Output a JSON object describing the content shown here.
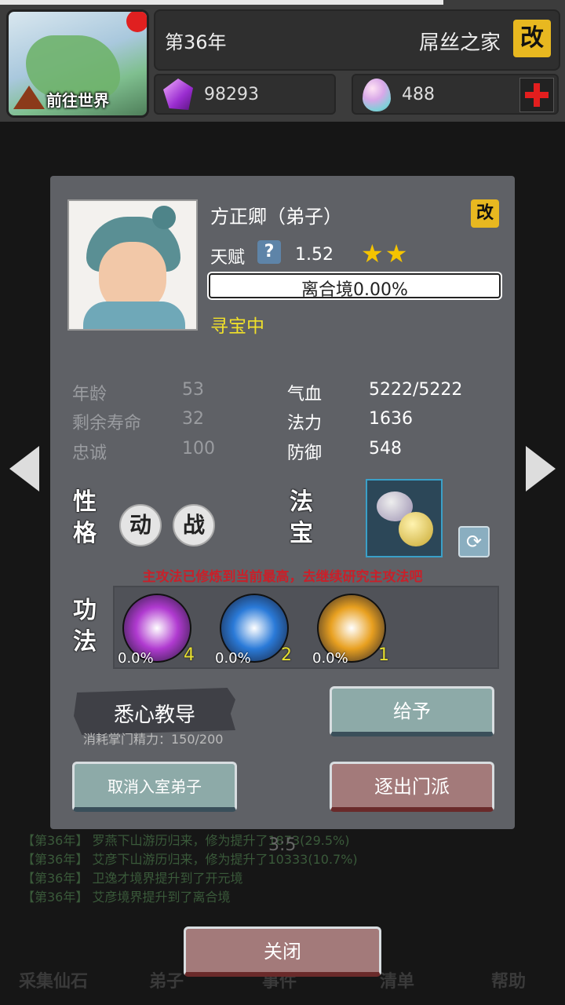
{
  "header": {
    "world_button_label": "前往世界",
    "year": "第36年",
    "sect_name": "屌丝之家",
    "rename_icon": "改",
    "spirit_stones": "98293",
    "eggs": "488"
  },
  "background": {
    "logs": [
      "【第36年】 罗燕下山游历归来，修为提升了1873(29.5%)",
      "【第36年】 艾彦下山游历归来，修为提升了10333(10.7%)",
      "【第36年】 卫逸才境界提升到了开元境",
      "【第36年】 艾彦境界提升到了离合境"
    ],
    "timer": "3:5",
    "bottom_tabs": [
      "采集仙石",
      "弟子",
      "事件",
      "清单",
      "帮助"
    ]
  },
  "disciple": {
    "name": "方正卿（弟子）",
    "rename_icon": "改",
    "talent_label": "天赋",
    "talent_help": "?",
    "talent_value": "1.52",
    "stars": "★★",
    "star_count": 2,
    "realm_progress_text": "离合境0.00%",
    "realm_progress": 0.0,
    "status": "寻宝中",
    "stats": {
      "age_label": "年龄",
      "age": "53",
      "life_label": "剩余寿命",
      "life": "32",
      "loyalty_label": "忠诚",
      "loyalty": "100",
      "hp_label": "气血",
      "hp": "5222/5222",
      "mana_label": "法力",
      "mana": "1636",
      "def_label": "防御",
      "def": "548"
    },
    "personality_label": [
      "性",
      "格"
    ],
    "traits": [
      "动",
      "战"
    ],
    "treasure_label": [
      "法",
      "宝"
    ],
    "refresh_icon": "⟳",
    "skills_hint": "主攻法已修炼到当前最高，去继续研究主攻法吧",
    "skills_label": [
      "功",
      "法"
    ],
    "skills": [
      {
        "progress": "0.0%",
        "level": "4",
        "color": "#b03ad0"
      },
      {
        "progress": "0.0%",
        "level": "2",
        "color": "#2a7ad8"
      },
      {
        "progress": "0.0%",
        "level": "1",
        "color": "#e8a020"
      }
    ]
  },
  "actions": {
    "teach_label": "悉心教导",
    "teach_cost": "消耗掌门精力：150/200",
    "give_label": "给予",
    "cancel_inner_label": "取消入室弟子",
    "expel_label": "逐出门派",
    "close_label": "关闭"
  }
}
